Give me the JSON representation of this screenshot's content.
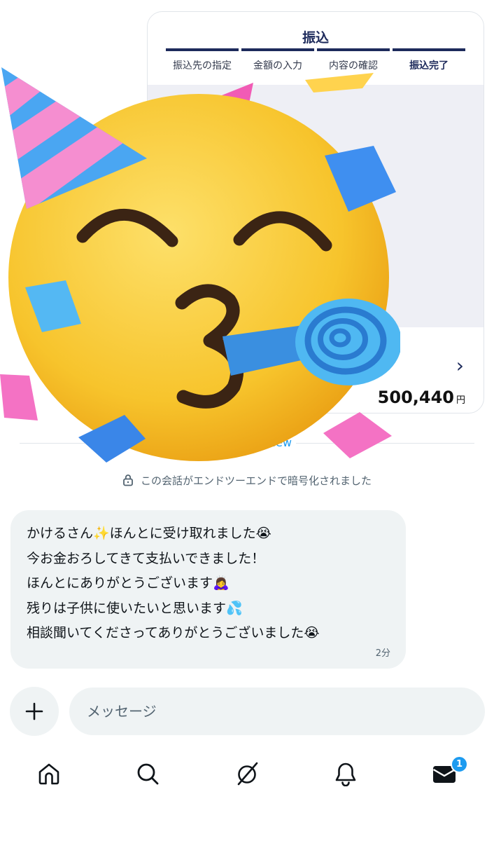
{
  "transfer_card": {
    "title": "振込",
    "steps": [
      "振込先の指定",
      "金額の入力",
      "内容の確認",
      "振込完了"
    ],
    "amount": "500,440",
    "amount_unit": "円"
  },
  "divider": {
    "new_label": "New"
  },
  "encryption_notice": "この会話がエンドツーエンドで暗号化されました",
  "message": {
    "lines": [
      "かけるさん✨ほんとに受け取れました😭",
      "今お金おろしてきて支払いできました！",
      "ほんとにありがとうございます🙇‍♀️",
      "残りは子供に使いたいと思います💦",
      "相談聞いてくださってありがとうございました😭"
    ],
    "time": "2分"
  },
  "composer": {
    "placeholder": "メッセージ"
  },
  "nav": {
    "icons": [
      "home-icon",
      "search-icon",
      "grok-icon",
      "bell-icon",
      "mail-icon"
    ],
    "badge_count": "1"
  },
  "colors": {
    "accent": "#1d9bf0",
    "bubble_bg": "#eff3f4",
    "bank_navy": "#1d2a5b",
    "emoji_yellow": "#f7c42c"
  }
}
